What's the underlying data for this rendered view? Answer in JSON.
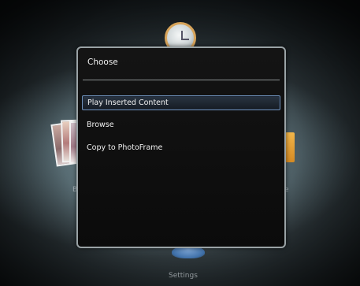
{
  "dialog": {
    "title": "Choose",
    "items": [
      {
        "label": "Play Inserted Content",
        "selected": true
      },
      {
        "label": "Browse",
        "selected": false
      },
      {
        "label": "Copy to PhotoFrame",
        "selected": false
      }
    ]
  },
  "background": {
    "left_label": "Br",
    "right_label": "e",
    "bottom_label": "Settings"
  },
  "colors": {
    "highlight_border": "#6d8fb8",
    "dialog_border": "#9aa3a6",
    "folder": "#f2b64a"
  }
}
